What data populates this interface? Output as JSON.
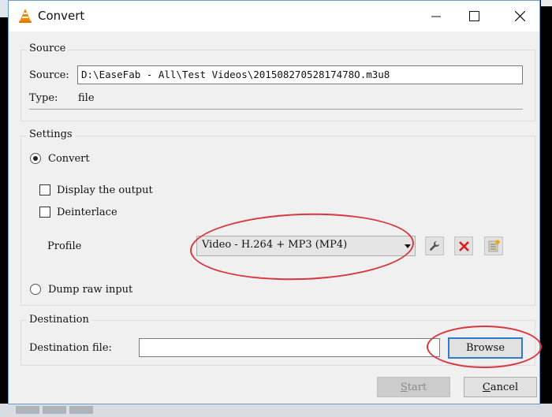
{
  "window": {
    "title": "Convert",
    "app_icon": "vlc-cone-icon",
    "controls": {
      "minimize": "minimize-icon",
      "maximize": "maximize-icon",
      "close": "close-icon"
    }
  },
  "source_group": {
    "title": "Source",
    "source_label": "Source:",
    "source_value": "D:\\EaseFab - All\\Test Videos\\20150827052817478O.m3u8",
    "type_label": "Type:",
    "type_value": "file"
  },
  "settings_group": {
    "title": "Settings",
    "convert_option": {
      "label": "Convert",
      "selected": true
    },
    "display_output": {
      "label": "Display the output",
      "checked": false
    },
    "deinterlace": {
      "label": "Deinterlace",
      "checked": false
    },
    "profile_label": "Profile",
    "profile_selected": "Video - H.264 + MP3 (MP4)",
    "profile_buttons": {
      "edit": "wrench-icon",
      "delete": "red-x-icon",
      "new": "new-profile-icon"
    },
    "dump_raw_option": {
      "label": "Dump raw input",
      "selected": false
    }
  },
  "destination_group": {
    "title": "Destination",
    "file_label": "Destination file:",
    "file_value": "",
    "browse_label": "Browse"
  },
  "footer": {
    "start_label": "Start",
    "start_mnemonic": "S",
    "start_rest": "tart",
    "start_enabled": false,
    "cancel_label": "Cancel",
    "cancel_mnemonic": "C",
    "cancel_rest": "ancel"
  },
  "annotations": {
    "color": "#d9363e",
    "highlighted": [
      "profile-combo",
      "browse-button"
    ]
  }
}
